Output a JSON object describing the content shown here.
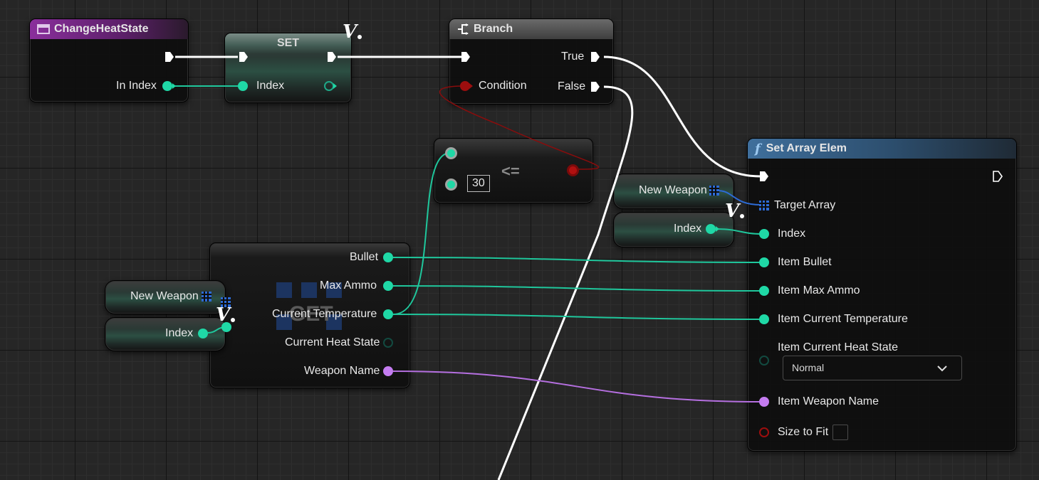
{
  "nodes": {
    "change_heat_state": {
      "title": "ChangeHeatState",
      "in_index": "In Index"
    },
    "set": {
      "title": "SET",
      "index": "Index"
    },
    "branch": {
      "title": "Branch",
      "condition": "Condition",
      "true_label": "True",
      "false_label": "False"
    },
    "compare": {
      "operator": "<=",
      "value": "30"
    },
    "new_weapon_right": {
      "label": "New Weapon"
    },
    "index_right": {
      "label": "Index"
    },
    "new_weapon_left": {
      "label": "New Weapon"
    },
    "index_left": {
      "label": "Index"
    },
    "get": {
      "watermark": "GET",
      "outputs": [
        "Bullet",
        "Max Ammo",
        "Current Temperature",
        "Current Heat State",
        "Weapon Name"
      ]
    },
    "set_array_elem": {
      "title": "Set Array Elem",
      "target_array": "Target Array",
      "index": "Index",
      "item_bullet": "Item Bullet",
      "item_max_ammo": "Item Max Ammo",
      "item_current_temperature": "Item Current Temperature",
      "item_current_heat_state": "Item Current Heat State",
      "heat_state_value": "Normal",
      "item_weapon_name": "Item Weapon Name",
      "size_to_fit": "Size to Fit"
    }
  },
  "colors": {
    "exec": "#ffffff",
    "int_pin": "#1fd8a6",
    "bool_pin": "#9c0e0e",
    "string_pin": "#c47cf0",
    "array_pin": "#2d6bd6",
    "function_header": "#3f6f9c",
    "event_header": "#8a2f9c"
  },
  "icons": {
    "function_node": "function-f-icon",
    "event_node": "event-icon",
    "branch_node": "branch-icon",
    "variable_marker": "variable-v-icon",
    "array_pin": "array-grid-icon",
    "dropdown": "chevron-down-icon"
  }
}
